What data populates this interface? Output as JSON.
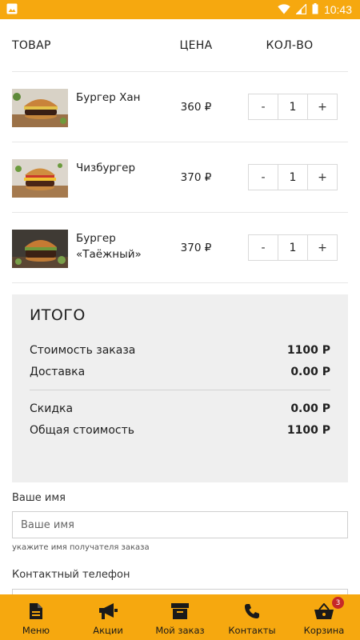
{
  "status_bar": {
    "time": "10:43",
    "bg_color": "#f6a80f"
  },
  "cart": {
    "headers": {
      "product": "ТОВАР",
      "price": "ЦЕНА",
      "qty": "КОЛ-ВО"
    },
    "items": [
      {
        "name": "Бургер Хан",
        "price": "360 ₽",
        "qty": "1",
        "minus": "-",
        "plus": "+"
      },
      {
        "name": "Чизбургер",
        "price": "370 ₽",
        "qty": "1",
        "minus": "-",
        "plus": "+"
      },
      {
        "name": "Бургер «Таёжный»",
        "price": "370 ₽",
        "qty": "1",
        "minus": "-",
        "plus": "+"
      }
    ]
  },
  "summary": {
    "title": "ИТОГО",
    "order_cost": {
      "label": "Стоимость заказа",
      "value": "1100 Р"
    },
    "delivery": {
      "label": "Доставка",
      "value": "0.00 Р"
    },
    "discount": {
      "label": "Скидка",
      "value": "0.00 Р"
    },
    "total": {
      "label": "Общая стоимость",
      "value": "1100 Р"
    }
  },
  "form": {
    "name_label": "Ваше имя",
    "name_placeholder": "Ваше имя",
    "name_hint": "укажите имя получателя заказа",
    "phone_label": "Контактный телефон"
  },
  "bottom_nav": {
    "items": [
      {
        "label": "Меню",
        "icon": "document-icon"
      },
      {
        "label": "Акции",
        "icon": "megaphone-icon"
      },
      {
        "label": "Мой заказ",
        "icon": "archive-box-icon"
      },
      {
        "label": "Контакты",
        "icon": "phone-icon"
      },
      {
        "label": "Корзина",
        "icon": "basket-icon",
        "badge": "3"
      }
    ]
  },
  "colors": {
    "accent": "#f6a80f",
    "summary_bg": "#efefef",
    "badge": "#c62828"
  }
}
